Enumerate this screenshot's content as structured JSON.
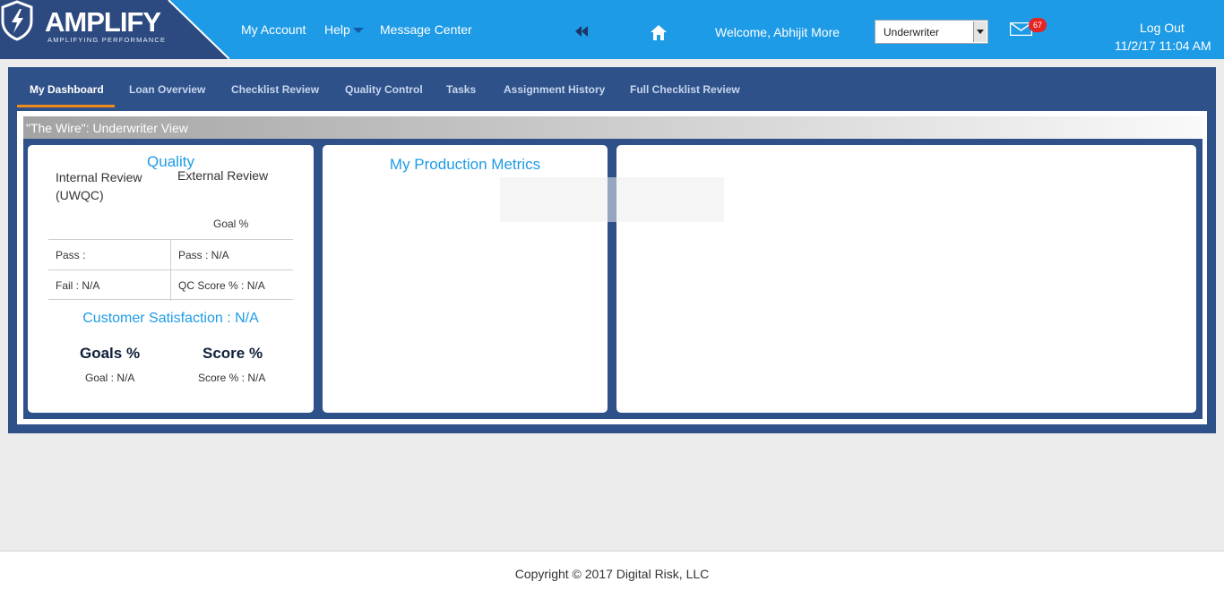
{
  "brand": {
    "name": "AMPLIFY",
    "tagline": "AMPLIFYING PERFORMANCE"
  },
  "topnav": {
    "my_account": "My Account",
    "help": "Help",
    "message_center": "Message Center",
    "welcome": "Welcome, Abhijit More",
    "role_selected": "Underwriter",
    "mail_count": "67",
    "logout": "Log Out",
    "datetime": "11/2/17 11:04 AM"
  },
  "tabs": [
    {
      "label": "My Dashboard",
      "active": true
    },
    {
      "label": "Loan Overview"
    },
    {
      "label": "Checklist Review"
    },
    {
      "label": "Quality Control"
    },
    {
      "label": "Tasks"
    },
    {
      "label": "Assignment History"
    },
    {
      "label": "Full Checklist Review"
    }
  ],
  "view_title": "\"The Wire\": Underwriter View",
  "quality": {
    "title": "Quality",
    "internal_review": "Internal Review (UWQC)",
    "external_review": "External Review",
    "goal_pct": "Goal %",
    "pass_left": "Pass :",
    "pass_right": "Pass : N/A",
    "fail_left": "Fail : N/A",
    "qc_score": "QC Score % : N/A",
    "customer_satisfaction": "Customer Satisfaction : N/A",
    "goals_heading": "Goals %",
    "score_heading": "Score %",
    "goal_value": "Goal : N/A",
    "score_value": "Score % : N/A"
  },
  "metrics": {
    "title": "My Production Metrics"
  },
  "footer": {
    "copyright": "Copyright © 2017 Digital Risk, LLC"
  },
  "colors": {
    "header_blue": "#1e9be6",
    "logo_navy": "#2d4a80",
    "frame_navy": "#2f5189",
    "tab_accent": "#f08a1c",
    "badge_red": "#e52424"
  },
  "icons": [
    "shield-logo-icon",
    "help-caret-icon",
    "double-back-icon",
    "home-icon",
    "mail-icon",
    "select-arrow-icon"
  ]
}
